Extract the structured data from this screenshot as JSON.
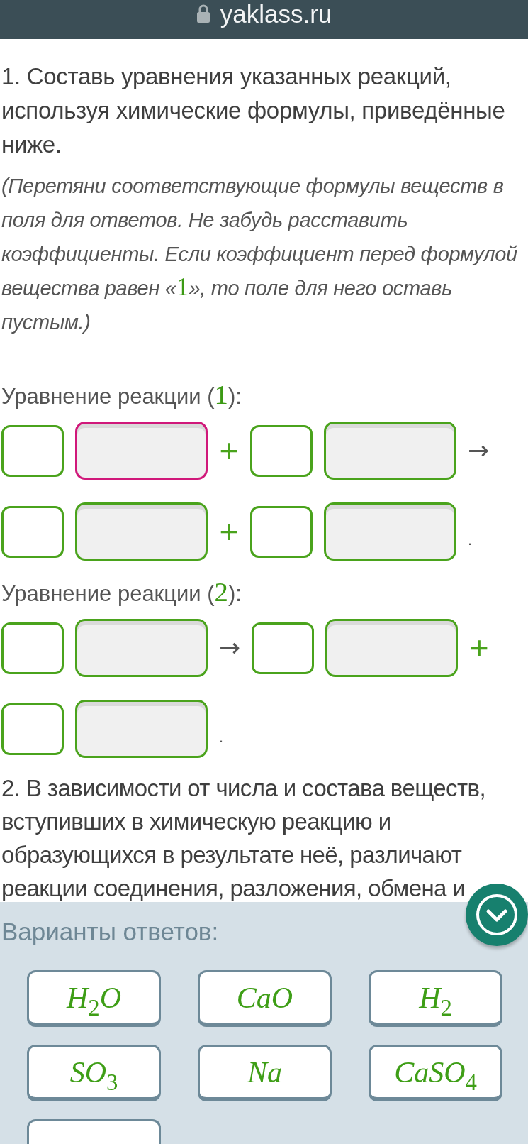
{
  "address_bar": {
    "url": "yaklass.ru"
  },
  "task_1": {
    "title": "1. Составь уравнения указанных реакций, используя химические формулы, приведённые ниже.",
    "hint": [
      {
        "kind": "text",
        "text": "(Перетяни соответствующие формулы веществ в поля для ответов. Не забудь расставить коэффициенты. Если коэффициент перед формулой вещества равен «"
      },
      {
        "kind": "math",
        "text": "1"
      },
      {
        "kind": "text",
        "text": "», то поле для него оставь пустым.)"
      }
    ],
    "equations": [
      {
        "label": [
          {
            "kind": "text",
            "text": "Уравнение реакции ("
          },
          {
            "kind": "math",
            "text": "1"
          },
          {
            "kind": "text",
            "text": "):"
          }
        ],
        "terms": [
          {
            "kind": "coefficient"
          },
          {
            "kind": "formula",
            "highlighted": true
          },
          {
            "kind": "plus",
            "text": "+"
          },
          {
            "kind": "coefficient"
          },
          {
            "kind": "formula",
            "highlighted": false
          },
          {
            "kind": "arrow",
            "text": "→"
          },
          {
            "kind": "coefficient"
          },
          {
            "kind": "formula",
            "highlighted": false
          },
          {
            "kind": "plus",
            "text": "+"
          },
          {
            "kind": "coefficient"
          },
          {
            "kind": "formula",
            "highlighted": false
          },
          {
            "kind": "end",
            "text": "."
          }
        ]
      },
      {
        "label": [
          {
            "kind": "text",
            "text": "Уравнение реакции ("
          },
          {
            "kind": "math",
            "text": "2"
          },
          {
            "kind": "text",
            "text": "):"
          }
        ],
        "terms": [
          {
            "kind": "coefficient"
          },
          {
            "kind": "formula",
            "highlighted": false
          },
          {
            "kind": "arrow",
            "text": "→"
          },
          {
            "kind": "coefficient"
          },
          {
            "kind": "formula",
            "highlighted": false
          },
          {
            "kind": "plus",
            "text": "+"
          },
          {
            "kind": "coefficient"
          },
          {
            "kind": "formula",
            "highlighted": false
          },
          {
            "kind": "end",
            "text": "."
          }
        ]
      }
    ]
  },
  "task_2": {
    "text": "2. В зависимости от числа и состава веществ, вступивших в химическую реакцию и образующихся в результате неё, различают реакции соединения, разложения, обмена и"
  },
  "answer_panel": {
    "title": "Варианты ответов:",
    "options": [
      {
        "kind": "formula",
        "formula": "H$_{2}$O"
      },
      {
        "kind": "formula",
        "formula": "CaO"
      },
      {
        "kind": "formula",
        "formula": "H$_{2}$"
      },
      {
        "kind": "formula",
        "formula": "SO$_{3}$"
      },
      {
        "kind": "formula",
        "formula": "Na"
      },
      {
        "kind": "formula",
        "formula": "CaSO$_{4}$"
      },
      {
        "kind": "partial"
      }
    ]
  }
}
